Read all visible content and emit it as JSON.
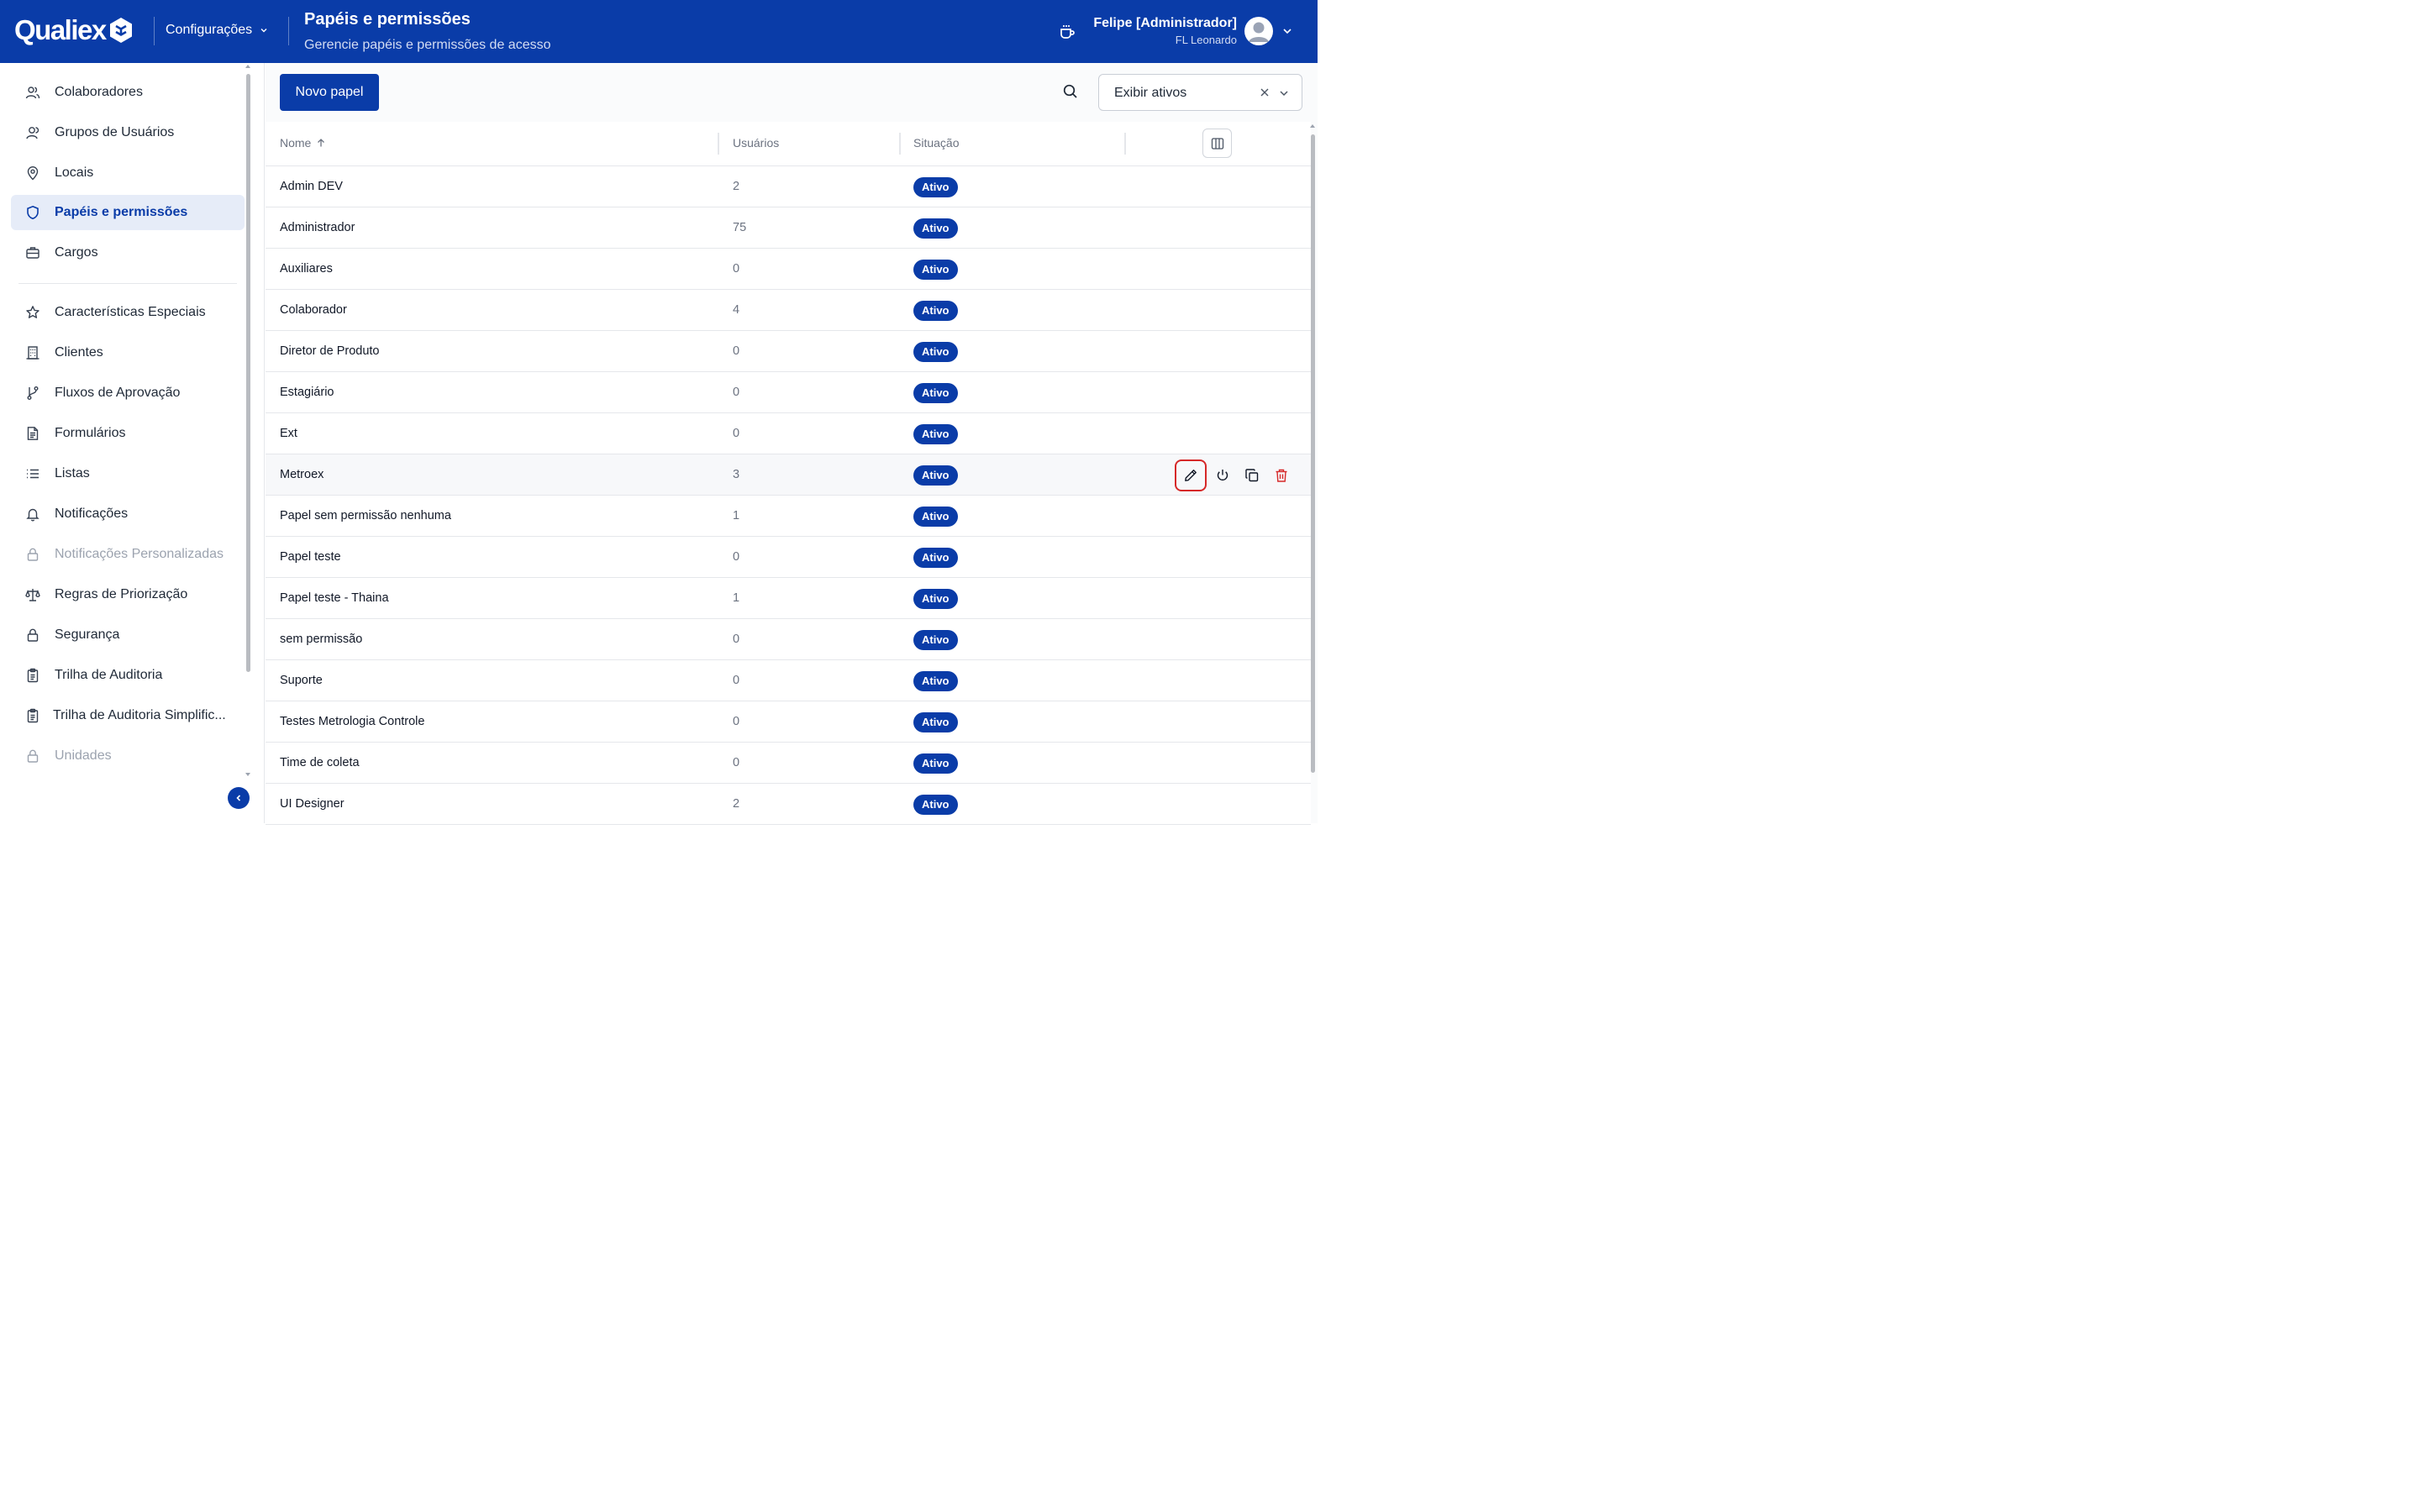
{
  "header": {
    "brand": "Qualiex",
    "module": "Configurações",
    "title": "Papéis e permissões",
    "subtitle": "Gerencie papéis e permissões de acesso",
    "user_name": "Felipe [Administrador]",
    "user_sub": "FL Leonardo",
    "icons": [
      "coffee-icon",
      "user-avatar-icon",
      "chevron-down-icon"
    ]
  },
  "sidebar": {
    "items": [
      {
        "label": "Colaboradores",
        "icon": "users-icon"
      },
      {
        "label": "Grupos de Usuários",
        "icon": "user-group-icon"
      },
      {
        "label": "Locais",
        "icon": "map-pin-icon"
      },
      {
        "label": "Papéis e permissões",
        "icon": "shield-icon",
        "active": true
      },
      {
        "label": "Cargos",
        "icon": "briefcase-icon"
      },
      {
        "label": "Características Especiais",
        "icon": "star-icon"
      },
      {
        "label": "Clientes",
        "icon": "building-icon"
      },
      {
        "label": "Fluxos de Aprovação",
        "icon": "git-branch-icon"
      },
      {
        "label": "Formulários",
        "icon": "file-text-icon"
      },
      {
        "label": "Listas",
        "icon": "list-icon"
      },
      {
        "label": "Notificações",
        "icon": "bell-icon"
      },
      {
        "label": "Notificações Personalizadas",
        "icon": "lock-icon",
        "disabled": true
      },
      {
        "label": "Regras de Priorização",
        "icon": "scale-icon"
      },
      {
        "label": "Segurança",
        "icon": "lock-icon"
      },
      {
        "label": "Trilha de Auditoria",
        "icon": "clipboard-icon"
      },
      {
        "label": "Trilha de Auditoria Simplific...",
        "icon": "clipboard-icon"
      },
      {
        "label": "Unidades",
        "icon": "lock-icon",
        "disabled": true
      }
    ]
  },
  "toolbar": {
    "new_button": "Novo papel",
    "filter_value": "Exibir ativos"
  },
  "table": {
    "columns": {
      "name": "Nome",
      "users": "Usuários",
      "status": "Situação"
    },
    "sort": "ascending",
    "rows": [
      {
        "name": "Admin DEV",
        "users": "2",
        "status": "Ativo"
      },
      {
        "name": "Administrador",
        "users": "75",
        "status": "Ativo"
      },
      {
        "name": "Auxiliares",
        "users": "0",
        "status": "Ativo"
      },
      {
        "name": "Colaborador",
        "users": "4",
        "status": "Ativo"
      },
      {
        "name": "Diretor de Produto",
        "users": "0",
        "status": "Ativo"
      },
      {
        "name": "Estagiário",
        "users": "0",
        "status": "Ativo"
      },
      {
        "name": "Ext",
        "users": "0",
        "status": "Ativo"
      },
      {
        "name": "Metroex",
        "users": "3",
        "status": "Ativo",
        "hovered": true
      },
      {
        "name": "Papel sem permissão nenhuma",
        "users": "1",
        "status": "Ativo"
      },
      {
        "name": "Papel teste",
        "users": "0",
        "status": "Ativo"
      },
      {
        "name": "Papel teste - Thaina",
        "users": "1",
        "status": "Ativo"
      },
      {
        "name": "sem permissão",
        "users": "0",
        "status": "Ativo"
      },
      {
        "name": "Suporte",
        "users": "0",
        "status": "Ativo"
      },
      {
        "name": "Testes Metrologia Controle",
        "users": "0",
        "status": "Ativo"
      },
      {
        "name": "Time de coleta",
        "users": "0",
        "status": "Ativo"
      },
      {
        "name": "UI Designer",
        "users": "2",
        "status": "Ativo"
      }
    ],
    "row_actions": [
      "pencil-icon",
      "power-icon",
      "copy-icon",
      "trash-icon"
    ]
  },
  "colors": {
    "brand": "#0a3ca8",
    "active_nav_bg": "#e6ecf8",
    "danger": "#d62828"
  }
}
